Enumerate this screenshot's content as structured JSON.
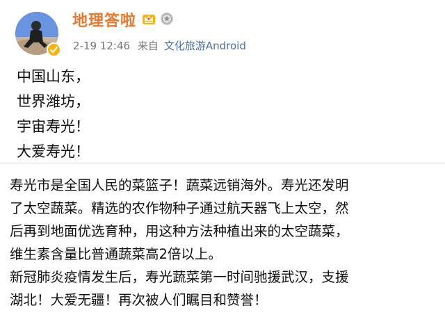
{
  "post": {
    "username": "地理答啦",
    "time": "2-19 12:46",
    "source_label": "来自",
    "source_app": "文化旅游Android",
    "lines": [
      "中国山东，",
      "世界潍坊，",
      "宇宙寿光！",
      "大爱寿光！"
    ]
  },
  "icons": {
    "avatar": "avatar-photo",
    "verified": "verified-badge-icon",
    "vip": "crown-badge-icon",
    "medal": "medal-badge-icon"
  },
  "caption": {
    "lines": [
      "寿光市是全国人民的菜篮子！蔬菜远销海外。寿光还发明",
      "了太空蔬菜。精选的农作物种子通过航天器飞上太空，然",
      "后再到地面优选育种，用这种方法种植出来的太空蔬菜，",
      "维生素含量比普通蔬菜高2倍以上。",
      "新冠肺炎疫情发生后，寿光蔬菜第一时间驰援武汉，支援",
      "湖北！大爱无疆！再次被人们瞩目和赞誉！"
    ]
  },
  "colors": {
    "username": "#e8782d",
    "link": "#4a6fa6",
    "meta": "#777777",
    "text": "#111111"
  }
}
